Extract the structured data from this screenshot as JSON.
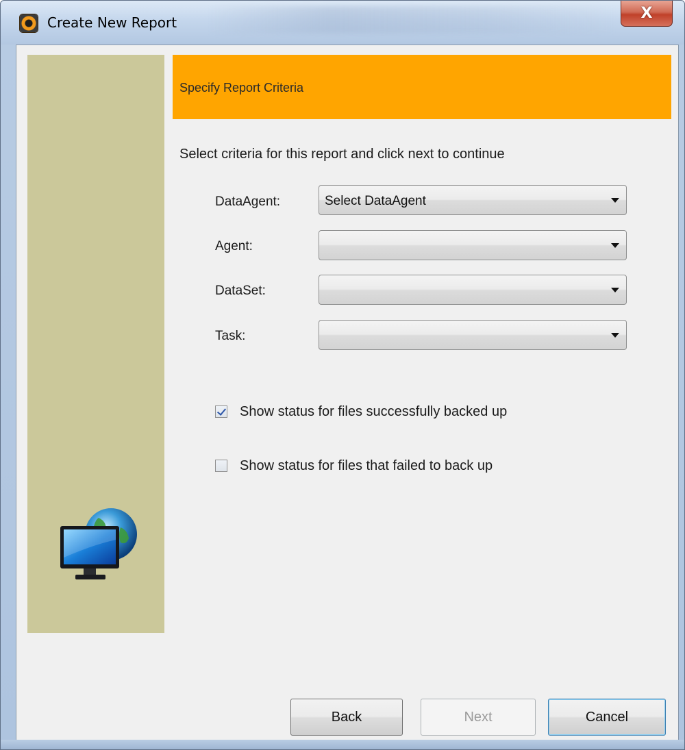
{
  "window": {
    "title": "Create New Report",
    "close_glyph": "X"
  },
  "wizard": {
    "step_title": "Specify Report Criteria",
    "instruction": "Select criteria for this report and click next to continue"
  },
  "fields": [
    {
      "label": "DataAgent:",
      "value": "Select DataAgent"
    },
    {
      "label": "Agent:",
      "value": ""
    },
    {
      "label": "DataSet:",
      "value": ""
    },
    {
      "label": "Task:",
      "value": ""
    }
  ],
  "options": [
    {
      "label": "Show status for files successfully backed up",
      "checked": true
    },
    {
      "label": "Show status for files that failed to back up",
      "checked": false
    }
  ],
  "buttons": {
    "back": "Back",
    "next": "Next",
    "cancel": "Cancel"
  },
  "colors": {
    "header_accent": "#ffa500",
    "side_panel": "#cbc89a"
  },
  "icons": {
    "app": "app-icon",
    "side_image": "computer-globe-icon"
  }
}
